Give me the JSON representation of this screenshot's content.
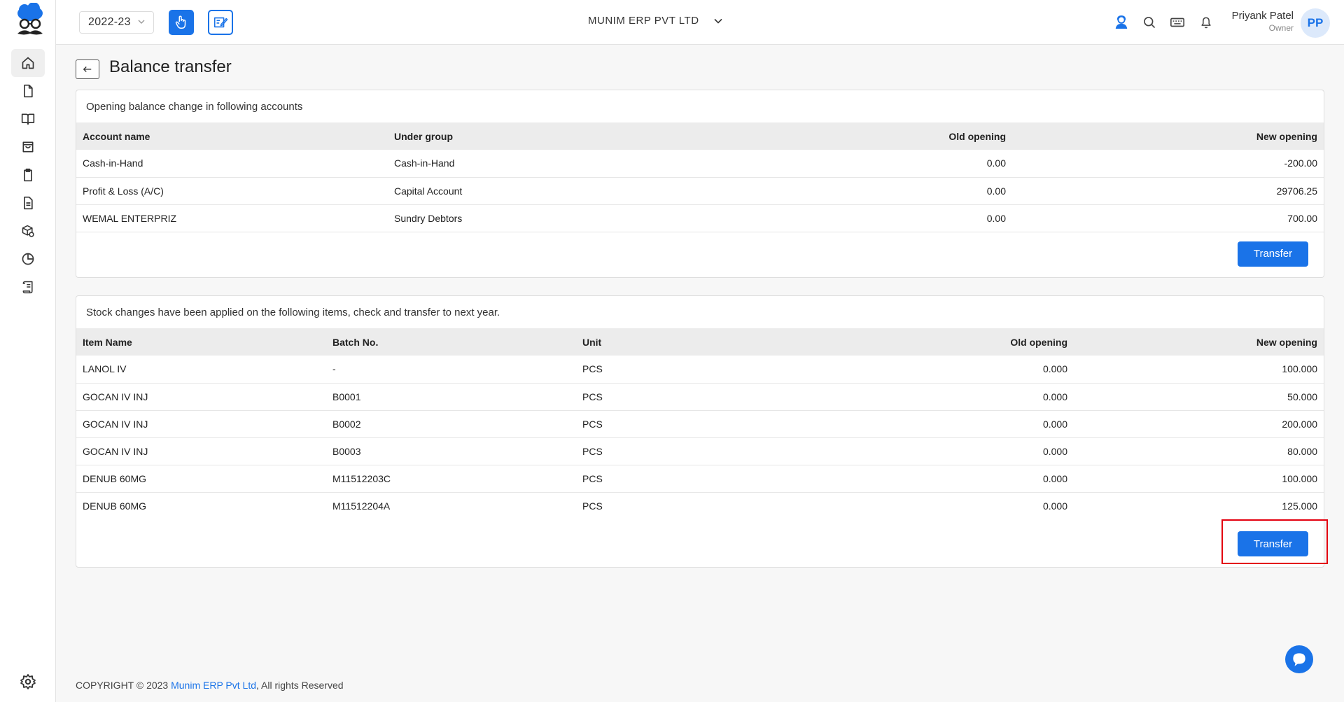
{
  "topbar": {
    "financial_year": "2022-23",
    "company": "MUNIM ERP PVT LTD",
    "user_name": "Priyank Patel",
    "user_role": "Owner",
    "avatar_initials": "PP"
  },
  "page": {
    "title": "Balance transfer"
  },
  "accounts_card": {
    "heading": "Opening balance change in following accounts",
    "columns": [
      "Account name",
      "Under group",
      "Old opening",
      "New opening"
    ],
    "rows": [
      [
        "Cash-in-Hand",
        "Cash-in-Hand",
        "0.00",
        "-200.00"
      ],
      [
        "Profit & Loss (A/C)",
        "Capital Account",
        "0.00",
        "29706.25"
      ],
      [
        "WEMAL ENTERPRIZ",
        "Sundry Debtors",
        "0.00",
        "700.00"
      ]
    ],
    "button": "Transfer"
  },
  "stock_card": {
    "heading": "Stock changes have been applied on the following items, check and transfer to next year.",
    "columns": [
      "Item Name",
      "Batch No.",
      "Unit",
      "Old opening",
      "New opening"
    ],
    "rows": [
      [
        "LANOL IV",
        "-",
        "PCS",
        "0.000",
        "100.000"
      ],
      [
        "GOCAN IV INJ",
        "B0001",
        "PCS",
        "0.000",
        "50.000"
      ],
      [
        "GOCAN IV INJ",
        "B0002",
        "PCS",
        "0.000",
        "200.000"
      ],
      [
        "GOCAN IV INJ",
        "B0003",
        "PCS",
        "0.000",
        "80.000"
      ],
      [
        "DENUB 60MG",
        "M11512203C",
        "PCS",
        "0.000",
        "100.000"
      ],
      [
        "DENUB 60MG",
        "M11512204A",
        "PCS",
        "0.000",
        "125.000"
      ]
    ],
    "button": "Transfer"
  },
  "footer": {
    "prefix": "COPYRIGHT © 2023 ",
    "link": "Munim ERP Pvt Ltd",
    "suffix": ", All rights Reserved"
  },
  "colors": {
    "accent": "#1a73e8",
    "highlight": "#e3000f"
  },
  "icons": [
    "home-icon",
    "file-icon",
    "book-icon",
    "bag-icon",
    "clipboard-icon",
    "document-icon",
    "box-gear-icon",
    "pie-chart-icon",
    "ledger-icon",
    "settings-icon"
  ]
}
